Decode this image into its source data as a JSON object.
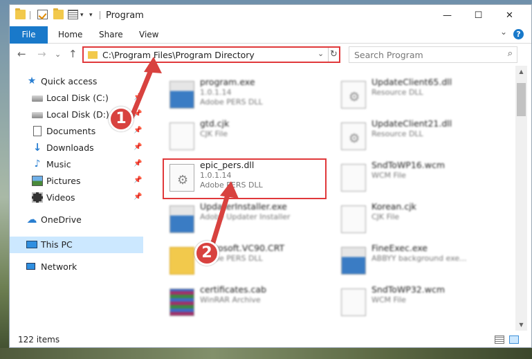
{
  "window": {
    "title": "Program",
    "controls": {
      "minimize": "—",
      "maximize": "☐",
      "close": "✕"
    }
  },
  "ribbon": {
    "tabs": [
      "File",
      "Home",
      "Share",
      "View"
    ],
    "expand_glyph": "⌄",
    "help_glyph": "?"
  },
  "navigation": {
    "back": "←",
    "forward": "→",
    "recent": "⌄",
    "up": "↑",
    "address": "C:\\Program Files\\Program Directory",
    "address_dropdown": "⌄",
    "refresh": "↻",
    "search_placeholder": "Search Program",
    "search_glyph": "⌕"
  },
  "nav_pane": {
    "items": [
      {
        "label": "Quick access",
        "icon": "star-icon"
      },
      {
        "label": "Local Disk (C:)",
        "icon": "drive-icon",
        "pinned": true
      },
      {
        "label": "Local Disk (D:)",
        "icon": "drive-icon",
        "pinned": true
      },
      {
        "label": "Documents",
        "icon": "documents-icon",
        "pinned": true
      },
      {
        "label": "Downloads",
        "icon": "download-icon",
        "pinned": true
      },
      {
        "label": "Music",
        "icon": "music-icon",
        "pinned": true
      },
      {
        "label": "Pictures",
        "icon": "pictures-icon",
        "pinned": true
      },
      {
        "label": "Videos",
        "icon": "videos-icon",
        "pinned": true
      },
      {
        "label": "OneDrive",
        "icon": "cloud-icon"
      },
      {
        "label": "This PC",
        "icon": "computer-icon",
        "selected": true
      },
      {
        "label": "Network",
        "icon": "network-icon"
      }
    ],
    "pin_glyph": "📌"
  },
  "files": [
    {
      "name": "program.exe",
      "line1": "1.0.1.14",
      "line2": "Adobe PERS DLL",
      "type": "exe",
      "blurred": true
    },
    {
      "name": "UpdateClient65.dll",
      "line1": "Resource DLL",
      "line2": "",
      "type": "gear",
      "blurred": true
    },
    {
      "name": "gtd.cjk",
      "line1": "CJK File",
      "line2": "",
      "type": "blank",
      "blurred": true
    },
    {
      "name": "UpdateClient21.dll",
      "line1": "Resource DLL",
      "line2": "",
      "type": "gear",
      "blurred": true
    },
    {
      "name": "epic_pers.dll",
      "line1": "1.0.1.14",
      "line2": "Adobe PERS DLL",
      "type": "gear",
      "blurred": false
    },
    {
      "name": "SndToWP16.wcm",
      "line1": "WCM File",
      "line2": "",
      "type": "blank",
      "blurred": true
    },
    {
      "name": "UpdaterInstaller.exe",
      "line1": "Adobe Updater Installer",
      "line2": "",
      "type": "exe",
      "blurred": true
    },
    {
      "name": "Korean.cjk",
      "line1": "CJK File",
      "line2": "",
      "type": "blank",
      "blurred": true
    },
    {
      "name": "Microsoft.VC90.CRT",
      "line1": "Adobe PERS DLL",
      "line2": "",
      "type": "folder",
      "blurred": true
    },
    {
      "name": "FineExec.exe",
      "line1": "ABBYY background exe...",
      "line2": "",
      "type": "exe",
      "blurred": true
    },
    {
      "name": "certificates.cab",
      "line1": "WinRAR Archive",
      "line2": "",
      "type": "archive",
      "blurred": true
    },
    {
      "name": "SndToWP32.wcm",
      "line1": "WCM File",
      "line2": "",
      "type": "blank",
      "blurred": true
    }
  ],
  "status": {
    "item_count": "122 items"
  },
  "callouts": [
    {
      "number": "1",
      "color": "#d8423f"
    },
    {
      "number": "2",
      "color": "#d8423f"
    }
  ],
  "colors": {
    "accent": "#1979ca",
    "highlight": "#e0383a",
    "selection": "#cce8ff"
  }
}
